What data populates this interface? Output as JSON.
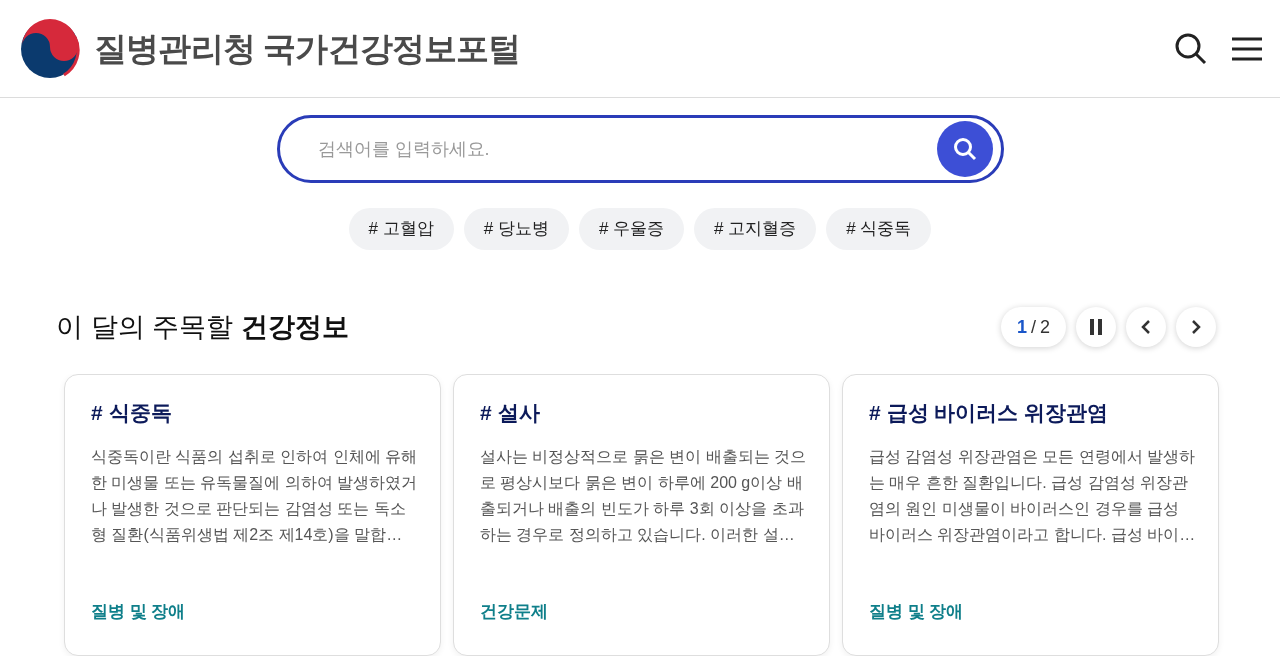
{
  "header": {
    "logo_text": "질병관리청 국가건강정보포털"
  },
  "search": {
    "placeholder": "검색어를 입력하세요."
  },
  "hashtags": [
    {
      "label": "# 고혈압"
    },
    {
      "label": "# 당뇨병"
    },
    {
      "label": "# 우울증"
    },
    {
      "label": "# 고지혈증"
    },
    {
      "label": "# 식중독"
    }
  ],
  "section": {
    "title": "이 달의 주목할 **건강정보**"
  },
  "pager": {
    "current": "1",
    "separator": "/",
    "total": "2",
    "paused": false
  },
  "cards": [
    {
      "title": "# 식중독",
      "body": "식중독이란 식품의 섭취로 인하여 인체에 유해한 미생물 또는 유독물질에 의하여 발생하였거나 발생한 것으로 판단되는 감염성 또는 독소형 질환(식품위생법 제2조 제14호)을 말합…",
      "category": "질병 및 장애"
    },
    {
      "title": "# 설사",
      "body": "설사는 비정상적으로 묽은 변이 배출되는 것으로 평상시보다 묽은 변이 하루에 200 g이상 배출되거나 배출의 빈도가 하루 3회 이상을 초과하는 경우로 정의하고 있습니다. 이러한 설…",
      "category": "건강문제"
    },
    {
      "title": "# 급성 바이러스 위장관염",
      "body": "급성 감염성 위장관염은 모든 연령에서 발생하는 매우 흔한 질환입니다. 급성 감염성 위장관염의 원인 미생물이 바이러스인 경우를 급성 바이러스 위장관염이라고 합니다. 급성 바이…",
      "category": "질병 및 장애"
    }
  ]
}
